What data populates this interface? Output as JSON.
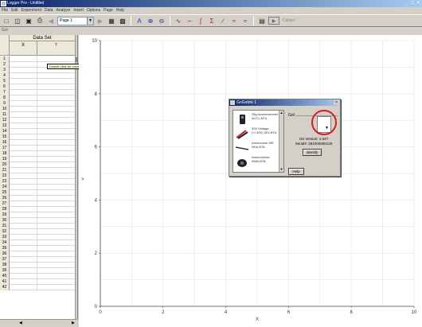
{
  "window": {
    "title": "Logger Pro - Untitled",
    "controls": "_ □ ×"
  },
  "menu": [
    "File",
    "Edit",
    "Experiment",
    "Data",
    "Analyze",
    "Insert",
    "Options",
    "Page",
    "Help"
  ],
  "toolbar": {
    "page_label": "Page 1",
    "collect_label": "Collect"
  },
  "status_text": "Gol",
  "table": {
    "title": "Data Set",
    "col_x": "X",
    "col_y": "Y",
    "tooltip": "Double click for column options",
    "rows": [
      "1",
      "2",
      "3",
      "4",
      "5",
      "6",
      "7",
      "8",
      "9",
      "10",
      "11",
      "12",
      "13",
      "14",
      "15",
      "16",
      "17",
      "18",
      "19",
      "20",
      "21",
      "22",
      "23",
      "24",
      "25",
      "26",
      "27",
      "28",
      "29",
      "30",
      "31",
      "32",
      "33",
      "34",
      "35",
      "36",
      "37",
      "38",
      "39",
      "40",
      "41",
      "42"
    ]
  },
  "graph": {
    "x_ticks": [
      "0",
      "2",
      "4",
      "6",
      "8",
      "10"
    ],
    "y_ticks": [
      "0",
      "2",
      "4",
      "6",
      "8",
      "10"
    ],
    "xlabel": "X",
    "ylabel": ""
  },
  "chart_data": {
    "type": "scatter",
    "x": [],
    "y": [],
    "xlabel": "X",
    "ylabel": "",
    "xlim": [
      0,
      10
    ],
    "ylim": [
      0,
      10
    ],
    "grid": true
  },
  "dialog": {
    "title": "GoGolink 1",
    "close": "×",
    "gol_label": "Gol",
    "sensors": [
      {
        "name": "25g Accelerometer",
        "model": "ACCL-BTA"
      },
      {
        "name": "30V Voltage",
        "model": "(+/-30V) 30V-BTA"
      },
      {
        "name": "Ammonium ISE",
        "model": "NH4-BTA"
      },
      {
        "name": "Anemometer",
        "model": "ANM-BTA"
      }
    ],
    "os_version": "OS Version: 1.04T",
    "serial": "Serial#: 281000000130",
    "identify_label": "Identify",
    "help_label": "Help"
  },
  "colors": {
    "highlight_circle": "#d32020",
    "y_header": "#d02020",
    "title_bar": "#0a246a"
  }
}
